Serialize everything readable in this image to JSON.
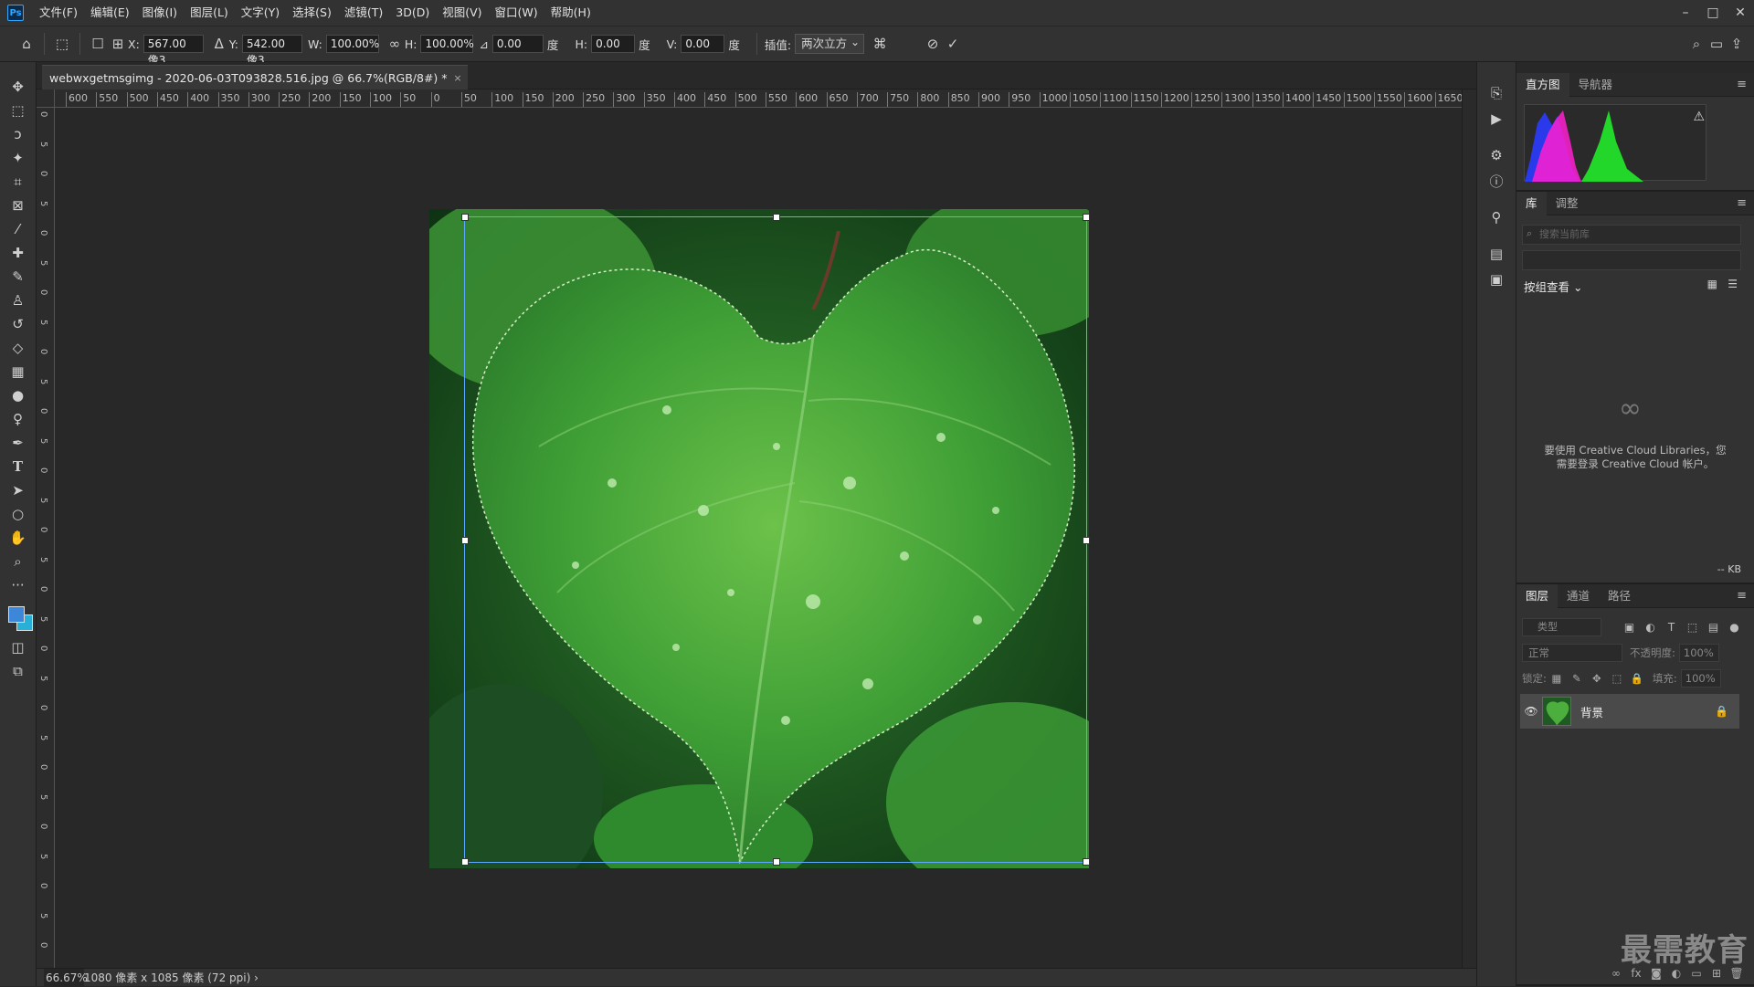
{
  "app": {
    "logo": "Ps"
  },
  "menu": [
    "文件(F)",
    "编辑(E)",
    "图像(I)",
    "图层(L)",
    "文字(Y)",
    "选择(S)",
    "滤镜(T)",
    "3D(D)",
    "视图(V)",
    "窗口(W)",
    "帮助(H)"
  ],
  "options": {
    "x_label": "X:",
    "x_value": "567.00 像3",
    "y_label": "Y:",
    "y_value": "542.00 像3",
    "w_label": "W:",
    "w_value": "100.00%",
    "h_label": "H:",
    "h_value": "100.00%",
    "angle_value": "0.00",
    "angle_unit": "度",
    "hskew_label": "H:",
    "hskew_value": "0.00",
    "hskew_unit": "度",
    "vskew_label": "V:",
    "vskew_value": "0.00",
    "vskew_unit": "度",
    "interp_label": "插值:",
    "interp_value": "两次立方"
  },
  "document": {
    "tab_title": "webwxgetmsgimg - 2020-06-03T093828.516.jpg @ 66.7%(RGB/8#) *",
    "close": "×"
  },
  "ruler": {
    "h_ticks": [
      "600",
      "550",
      "500",
      "450",
      "400",
      "350",
      "300",
      "250",
      "200",
      "150",
      "100",
      "50",
      "0",
      "50",
      "100",
      "150",
      "200",
      "250",
      "300",
      "350",
      "400",
      "450",
      "500",
      "550",
      "600",
      "650",
      "700",
      "750",
      "800",
      "850",
      "900",
      "950",
      "1000",
      "1050",
      "1100",
      "1150",
      "1200",
      "1250",
      "1300",
      "1350",
      "1400",
      "1450",
      "1500",
      "1550",
      "1600",
      "1650"
    ],
    "v_ticks": [
      "0",
      "5",
      "0",
      "5",
      "0",
      "5",
      "0",
      "5",
      "0",
      "5",
      "0",
      "5",
      "0",
      "5",
      "0",
      "5",
      "0",
      "5",
      "0",
      "5",
      "0",
      "5",
      "0",
      "5",
      "0",
      "5",
      "0",
      "5",
      "0"
    ]
  },
  "status": {
    "zoom": "66.67%",
    "info": "1080 像素 x 1085 像素 (72 ppi)",
    "arrow": "›"
  },
  "panels": {
    "histogram": {
      "tabs": [
        "直方图",
        "导航器"
      ],
      "warning": "⚠"
    },
    "library": {
      "tabs": [
        "库",
        "调整"
      ],
      "search_placeholder": "搜索当前库",
      "view_label": "按组查看",
      "message_line1": "要使用 Creative Cloud Libraries，您",
      "message_line2": "需要登录 Creative Cloud 帐户。",
      "kb": "-- KB"
    },
    "layers": {
      "tabs": [
        "图层",
        "通道",
        "路径"
      ],
      "filter_placeholder": "类型",
      "blend_mode": "正常",
      "opacity_label": "不透明度:",
      "opacity_value": "100%",
      "lock_label": "锁定:",
      "fill_label": "填充:",
      "fill_value": "100%",
      "layer_name": "背景"
    }
  },
  "watermark": "最需教育",
  "colors": {
    "foreground": "#3d87d8",
    "background": "#29b0d6",
    "accent": "#31a8ff"
  }
}
